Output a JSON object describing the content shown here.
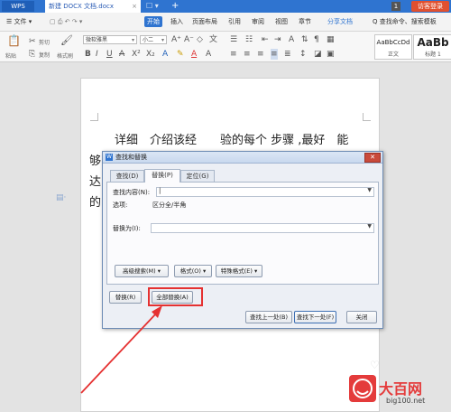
{
  "titlebar": {
    "app_name": "WPS",
    "doc_tab": "新建 DOCX 文档.docx",
    "tab_extra": "☐ ▾",
    "add_tab": "+",
    "badge": "1",
    "login": "访客登录"
  },
  "menubar": {
    "file": "☰ 文件 ▾",
    "items": [
      "开始",
      "插入",
      "页面布局",
      "引用",
      "审阅",
      "视图",
      "章节"
    ],
    "share": "分享文档",
    "search": "Q 查找命令、搜索模板"
  },
  "toolbar": {
    "paste": "粘贴",
    "cut": "剪切",
    "copy": "复制",
    "format_painter": "格式刷",
    "font_name": "微软雅黑",
    "font_size": "小二",
    "style_normal_preview": "AaBbCcDd",
    "style_normal": "正文",
    "style_heading_preview": "AaBb",
    "style_heading": "标题 1"
  },
  "document": {
    "line1": "详细　介绍该经　　验的每个 步骤 ,最好　能",
    "line2_start": "够",
    "line3_start": "达",
    "line4_start": "的"
  },
  "dialog": {
    "title": "查找和替换",
    "close": "✕",
    "tabs": {
      "find": "查找(D)",
      "replace": "替换(P)",
      "goto": "定位(G)"
    },
    "find_label": "查找内容(N):",
    "options_label": "选项:",
    "options_value": "区分全/半角",
    "replace_label": "替换为(I):",
    "advanced_search": "高级搜索(M) ▾",
    "format": "格式(O) ▾",
    "special_format": "特殊格式(E) ▾",
    "replace_button": "替换(R)",
    "replace_all_button": "全部替换(A)",
    "find_prev": "查找上一处(B)",
    "find_next": "查找下一处(F)",
    "close_button": "关闭"
  },
  "watermark": {
    "brand": "大百网",
    "url": "big100.net"
  },
  "colors": {
    "accent": "#2f74d0",
    "highlight": "#e53131"
  }
}
